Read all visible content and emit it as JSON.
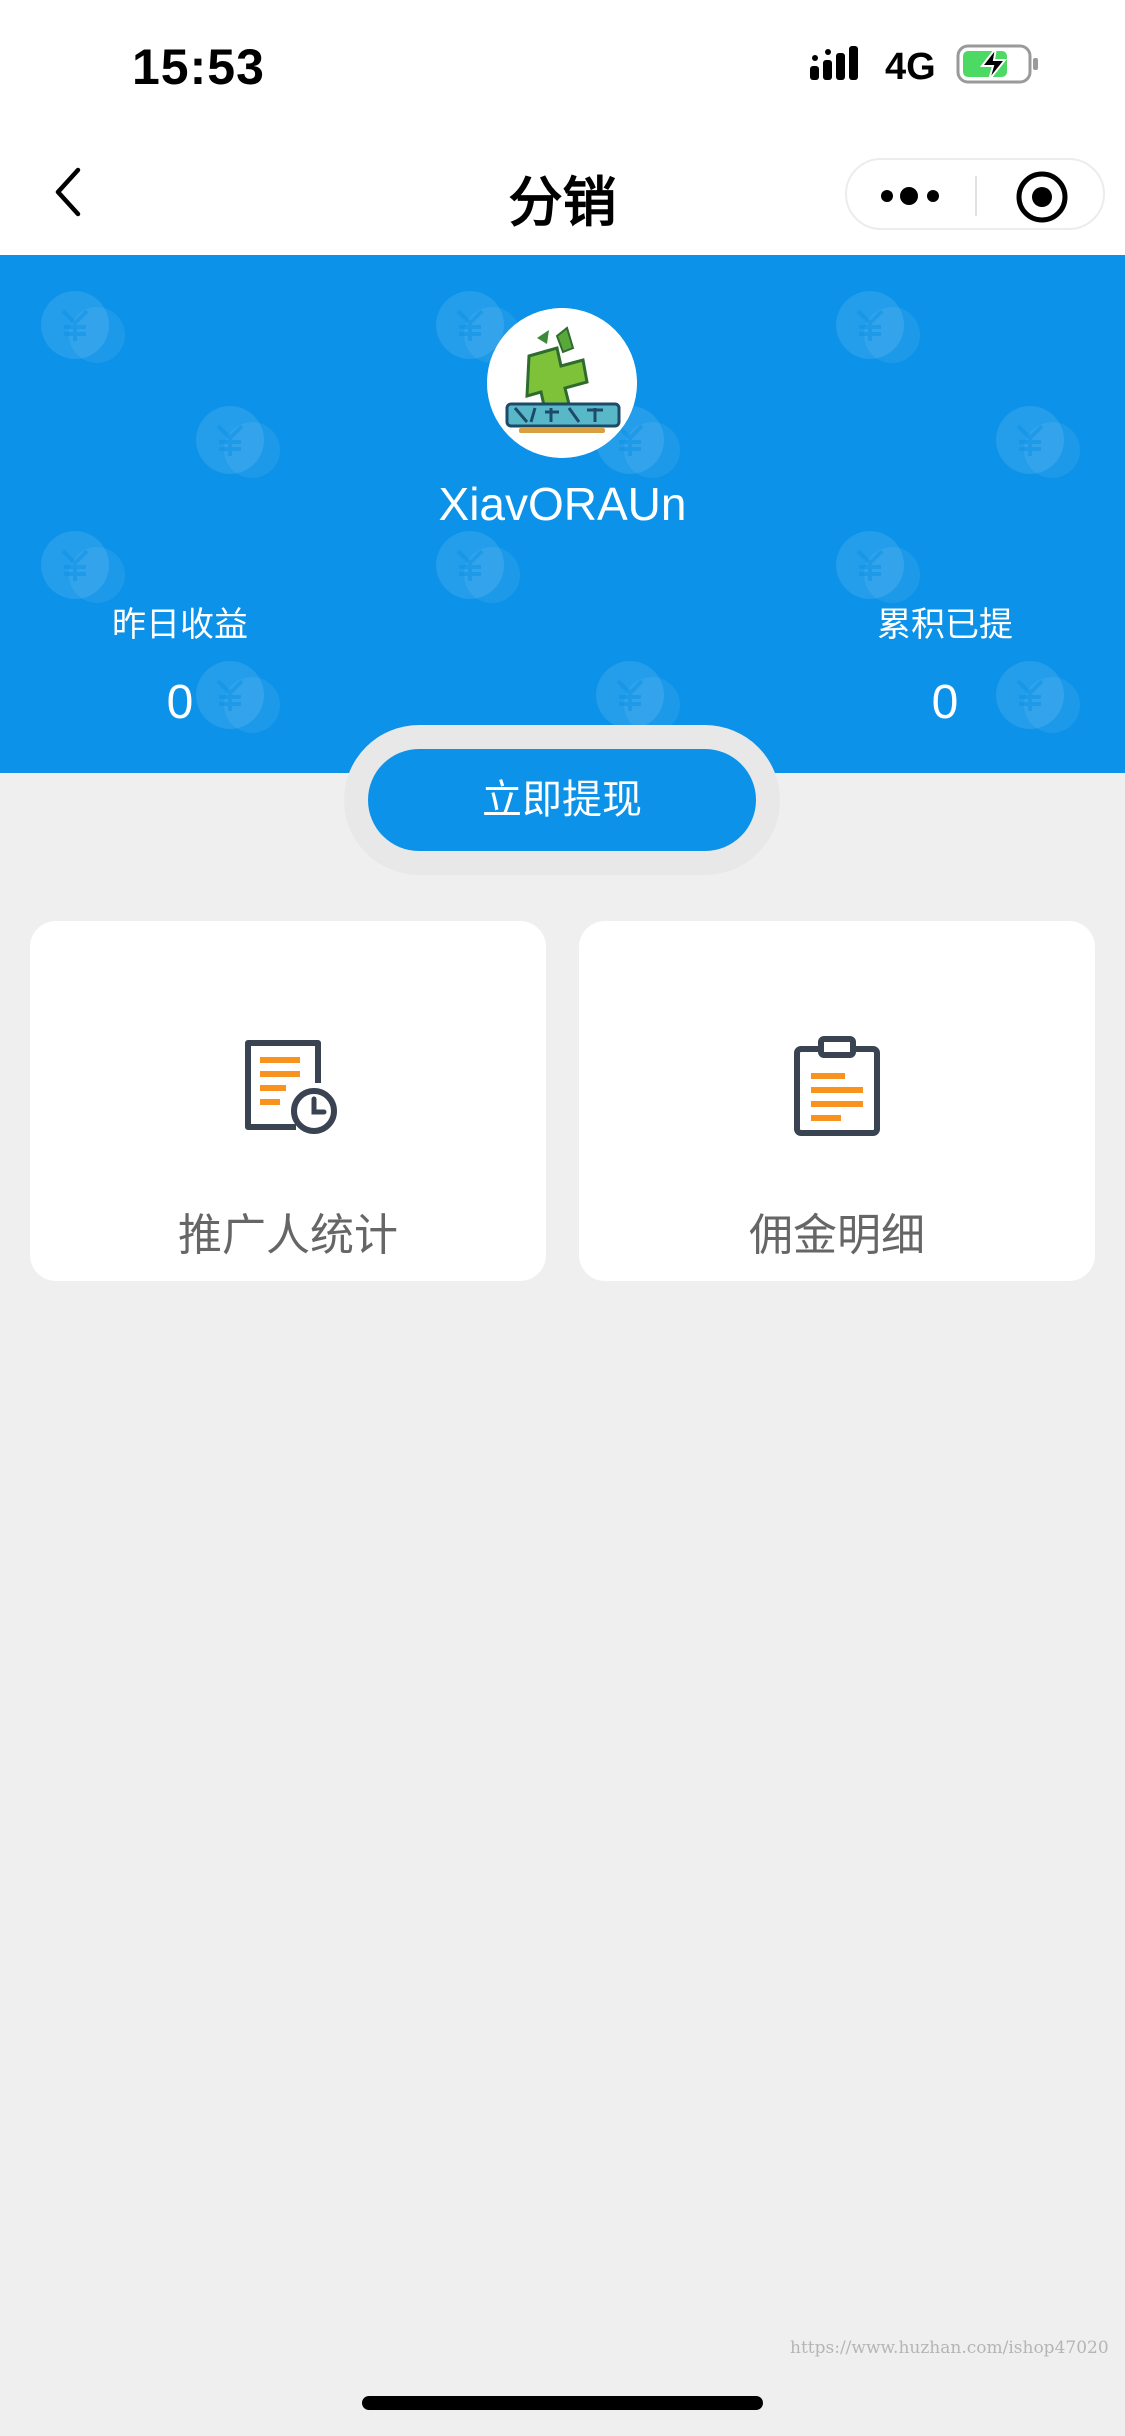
{
  "status_bar": {
    "time": "15:53",
    "network": "4G",
    "signal_icon": "signal-bars-icon",
    "battery_icon": "battery-charging-icon",
    "battery_color": "#4cd964"
  },
  "nav": {
    "title": "分销",
    "back_icon": "chevron-left-icon",
    "more_icon": "more-dots-icon",
    "close_icon": "target-circle-icon"
  },
  "header": {
    "background_color": "#0c92e8",
    "username": "XiavORAUn",
    "avatar_icon": "avatar-logo",
    "stats": [
      {
        "label": "昨日收益",
        "value": "0"
      },
      {
        "label": "累积已提",
        "value": "0"
      }
    ]
  },
  "withdraw_button": {
    "label": "立即提现",
    "color": "#0c92e8"
  },
  "cards": [
    {
      "label": "推广人统计",
      "icon": "document-clock-icon"
    },
    {
      "label": "佣金明细",
      "icon": "clipboard-list-icon"
    }
  ],
  "accent_orange": "#f7931e",
  "watermark": "https://www.huzhan.com/ishop47020"
}
